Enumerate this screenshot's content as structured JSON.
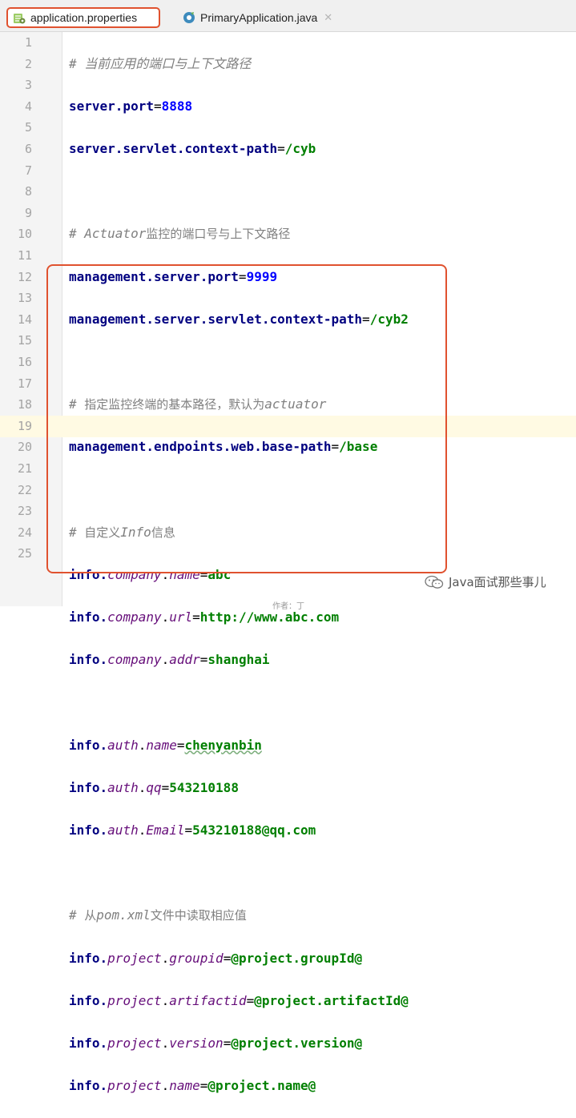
{
  "tabs": [
    {
      "label": "application.properties",
      "active": true
    },
    {
      "label": "PrimaryApplication.java",
      "active": false
    }
  ],
  "line_numbers": [
    "1",
    "2",
    "3",
    "4",
    "5",
    "6",
    "7",
    "8",
    "9",
    "10",
    "11",
    "12",
    "13",
    "14",
    "15",
    "16",
    "17",
    "18",
    "19",
    "20",
    "21",
    "22",
    "23",
    "24",
    "25"
  ],
  "lines": {
    "l1": {
      "comment": "# 当前应用的端口与上下文路径"
    },
    "l2": {
      "key": "server.port",
      "eq": "=",
      "value": "8888"
    },
    "l3": {
      "key": "server.servlet.context-path",
      "eq": "=",
      "value": "/cyb"
    },
    "l5": {
      "hash": "# ",
      "italic": "Actuator",
      "rest": "监控的端口号与上下文路径"
    },
    "l6": {
      "key": "management.server.port",
      "eq": "=",
      "value": "9999"
    },
    "l7": {
      "key": "management.server.servlet.context-path",
      "eq": "=",
      "value": "/cyb2"
    },
    "l9": {
      "hash": "# ",
      "rest": "指定监控终端的基本路径，默认为",
      "italic": "actuator"
    },
    "l10": {
      "key": "management.endpoints.web.base-path",
      "eq": "=",
      "value": "/base"
    },
    "l12": {
      "hash": "# ",
      "pre": "自定义",
      "italic": "Info",
      "rest": "信息"
    },
    "l13": {
      "k1": "info",
      "dot": ".",
      "p1": "company",
      "p2": "name",
      "eq": "=",
      "value": "abc"
    },
    "l14": {
      "k1": "info",
      "p1": "company",
      "p2": "url",
      "eq": "=",
      "value": "http://www.abc.com"
    },
    "l15": {
      "k1": "info",
      "p1": "company",
      "p2": "addr",
      "eq": "=",
      "value": "shanghai"
    },
    "l17": {
      "k1": "info",
      "p1": "auth",
      "p2": "name",
      "eq": "=",
      "value": "chenyanbin"
    },
    "l18": {
      "k1": "info",
      "p1": "auth",
      "p2": "qq",
      "eq": "=",
      "value": "543210188"
    },
    "l19": {
      "k1": "info",
      "p1": "auth",
      "p2": "Email",
      "eq": "=",
      "value": "543210188@qq.com"
    },
    "l21": {
      "hash": "# ",
      "pre": "从",
      "italic": "pom.xml",
      "rest": "文件中读取相应值"
    },
    "l22": {
      "k1": "info",
      "p1": "project",
      "p2": "groupid",
      "eq": "=",
      "value": "@project.groupId@"
    },
    "l23": {
      "k1": "info",
      "p1": "project",
      "p2": "artifactid",
      "eq": "=",
      "value": "@project.artifactId@"
    },
    "l24": {
      "k1": "info",
      "p1": "project",
      "p2": "version",
      "eq": "=",
      "value": "@project.version@"
    },
    "l25": {
      "k1": "info",
      "p1": "project",
      "p2": "name",
      "eq": "=",
      "value": "@project.name@"
    }
  },
  "watermark": "Java面试那些事儿",
  "footer_fragment": "作者：丁",
  "colors": {
    "highlight_box": "#e0522f",
    "key": "#000080",
    "value": "#007f00",
    "number": "#0000ff",
    "comment": "#808080",
    "property_italic": "#660e7a"
  },
  "icons": {
    "tab1": "properties-file-icon",
    "tab2": "java-class-icon",
    "close": "close-icon"
  }
}
